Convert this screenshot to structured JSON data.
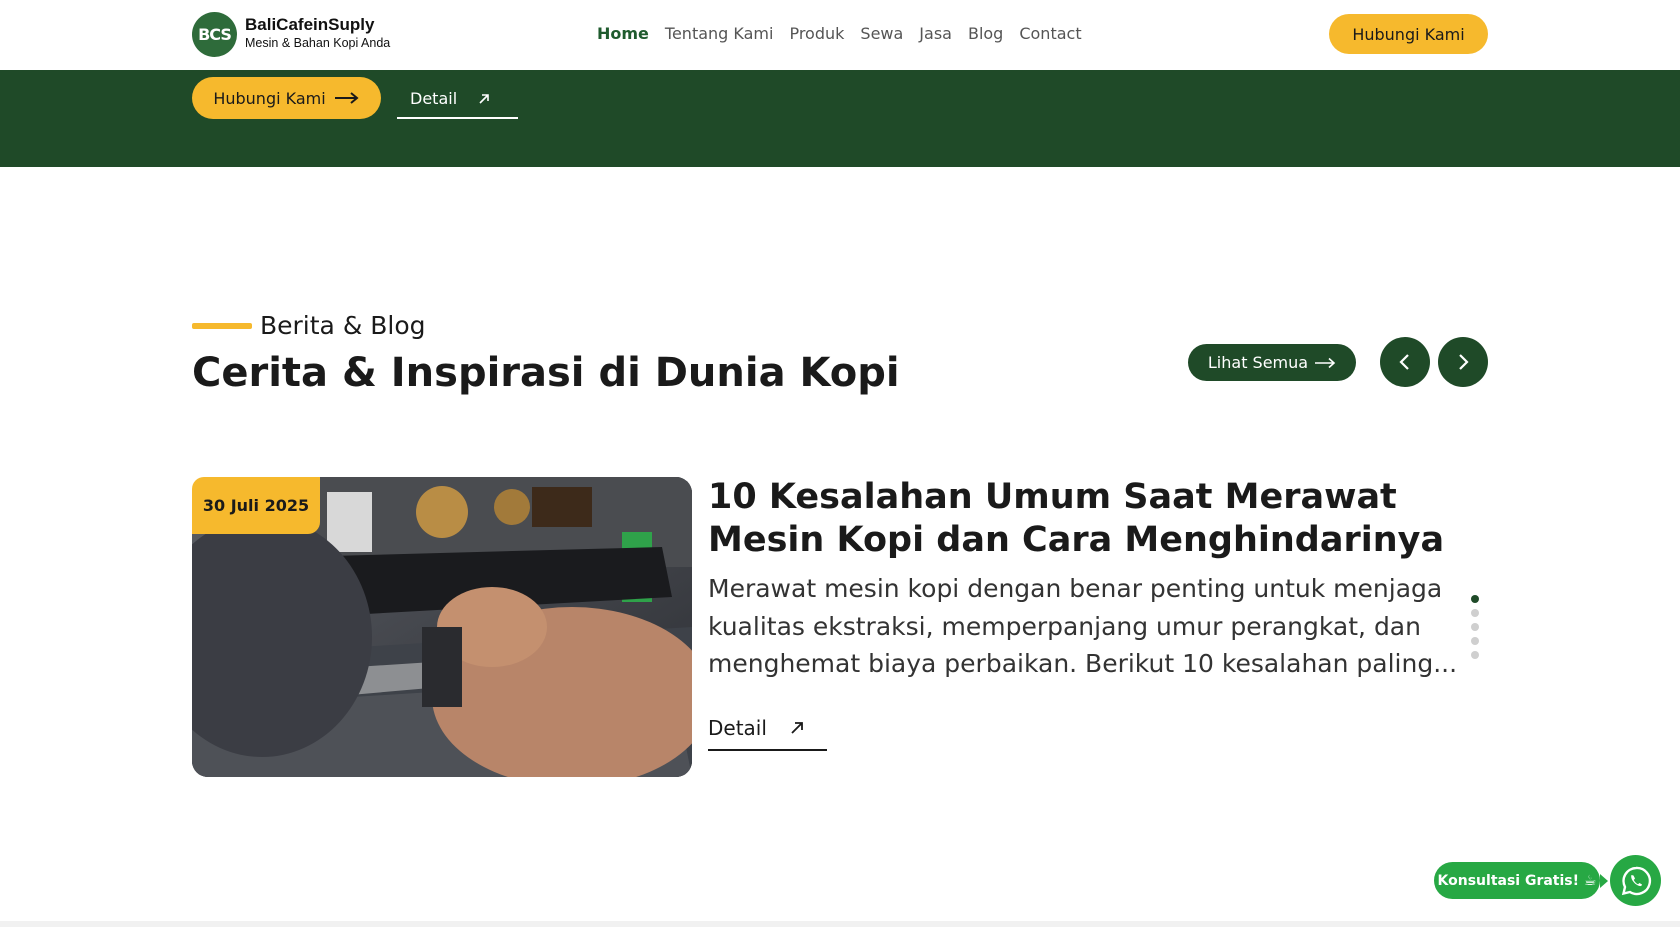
{
  "header": {
    "logo_text": "BCS",
    "brand_name": "BaliCafeinSuply",
    "brand_tagline": "Mesin & Bahan Kopi Anda",
    "nav": [
      {
        "label": "Home",
        "active": true
      },
      {
        "label": "Tentang Kami",
        "active": false
      },
      {
        "label": "Produk",
        "active": false
      },
      {
        "label": "Sewa",
        "active": false
      },
      {
        "label": "Jasa",
        "active": false
      },
      {
        "label": "Blog",
        "active": false
      },
      {
        "label": "Contact",
        "active": false
      }
    ],
    "cta_label": "Hubungi Kami"
  },
  "hero_band": {
    "cta_label": "Hubungi Kami",
    "detail_label": "Detail"
  },
  "blog": {
    "eyebrow": "Berita & Blog",
    "title": "Cerita & Inspirasi di Dunia Kopi",
    "see_all_label": "Lihat Semua",
    "post": {
      "date": "30 Juli 2025",
      "title": "10 Kesalahan Umum Saat Merawat Mesin Kopi dan Cara Menghindarinya",
      "excerpt": "Merawat mesin kopi dengan benar penting untuk menjaga kualitas ekstraksi, memperpanjang umur perangkat, dan menghemat biaya perbaikan. Berikut 10 kesalahan paling...",
      "detail_label": "Detail"
    },
    "carousel": {
      "total": 5,
      "active_index": 0
    }
  },
  "whatsapp": {
    "label": "Konsultasi Gratis! ☕"
  },
  "colors": {
    "primary_green": "#1f4a28",
    "accent_yellow": "#f6b92d",
    "whatsapp_green": "#27a844"
  }
}
